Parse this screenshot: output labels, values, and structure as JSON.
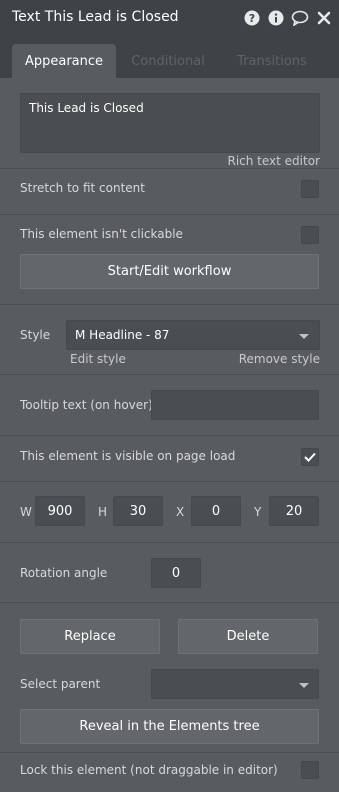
{
  "window": {
    "title": "Text This Lead is Closed"
  },
  "tabs": [
    {
      "label": "Appearance",
      "active": true
    },
    {
      "label": "Conditional",
      "active": false
    },
    {
      "label": "Transitions",
      "active": false
    }
  ],
  "content": {
    "text_value": "This Lead is Closed",
    "rich_text_editor_link": "Rich text editor"
  },
  "options": {
    "stretch_label": "Stretch to fit content",
    "stretch_checked": false,
    "not_clickable_label": "This element isn't clickable",
    "not_clickable_checked": false,
    "workflow_button": "Start/Edit workflow"
  },
  "style": {
    "label": "Style",
    "value": "M Headline - 87",
    "edit_link": "Edit style",
    "remove_link": "Remove style"
  },
  "tooltip": {
    "label": "Tooltip text (on hover)",
    "value": ""
  },
  "visibility": {
    "label": "This element is visible on page load",
    "checked": true
  },
  "geometry": {
    "w_label": "W",
    "w_value": "900",
    "h_label": "H",
    "h_value": "30",
    "x_label": "X",
    "x_value": "0",
    "y_label": "Y",
    "y_value": "20"
  },
  "rotation": {
    "label": "Rotation angle",
    "value": "0"
  },
  "actions": {
    "replace_button": "Replace",
    "delete_button": "Delete",
    "select_parent_label": "Select parent",
    "select_parent_value": "",
    "reveal_button": "Reveal in the Elements tree"
  },
  "lock": {
    "label": "Lock this element (not draggable in editor)",
    "checked": false
  }
}
